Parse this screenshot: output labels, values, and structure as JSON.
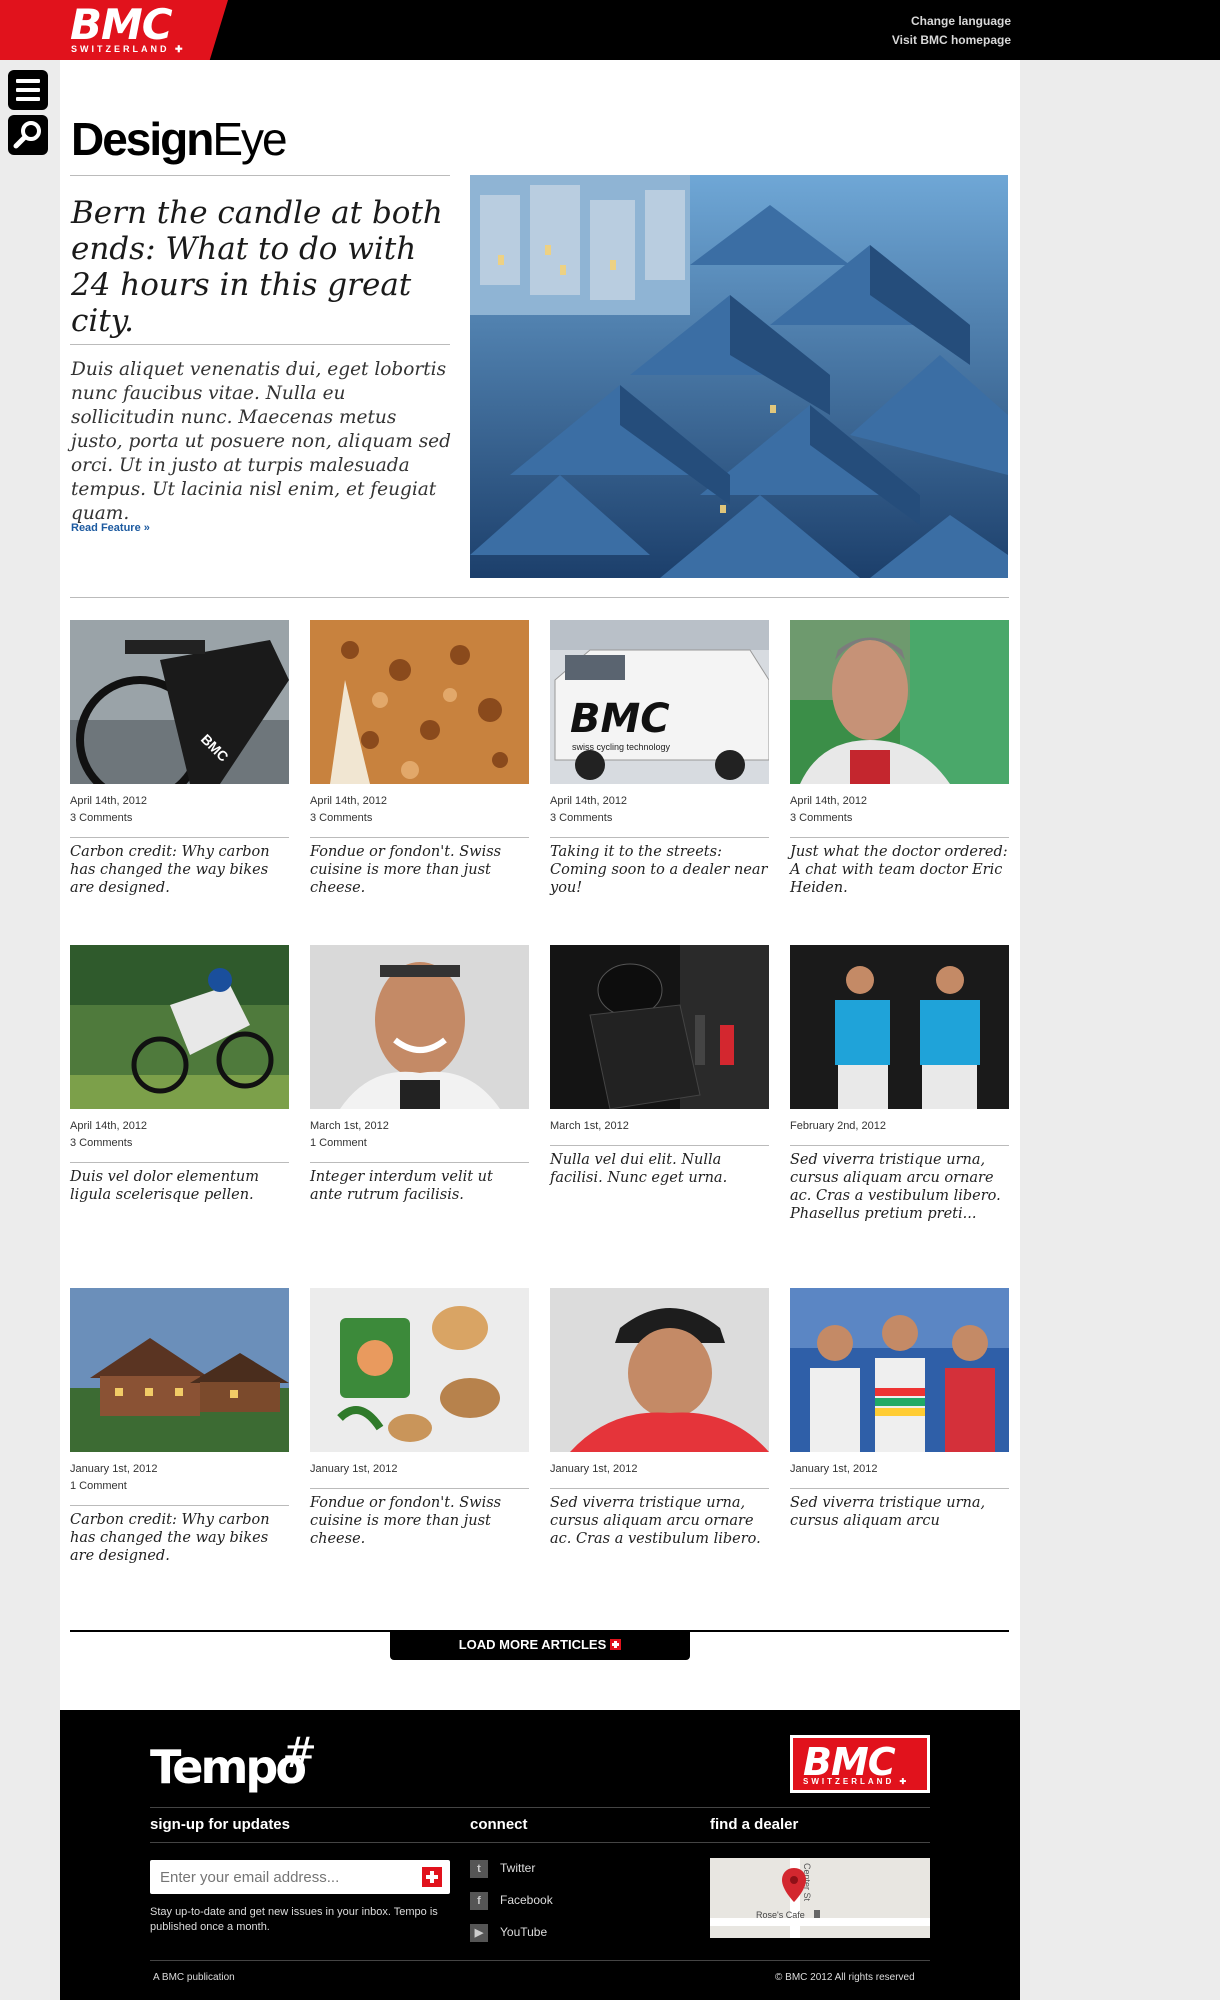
{
  "header": {
    "logo_text": "BMC",
    "logo_sub": "SWITZERLAND",
    "links": [
      "Change language",
      "Visit BMC homepage"
    ]
  },
  "brand": {
    "bold": "Design",
    "light": "Eye"
  },
  "hero": {
    "title": "Bern the candle at both ends: What to do with 24 hours in this great city.",
    "text": "Duis aliquet venenatis dui, eget lobortis nunc faucibus vitae. Nulla eu sollicitudin nunc. Maecenas metus justo, porta ut posuere non, aliquam sed orci. Ut in justo at turpis malesuada tempus. Ut lacinia nisl enim, et feugiat quam.",
    "read_more": "Read Feature »"
  },
  "articles": [
    {
      "date": "April 14th, 2012",
      "comments": "3 Comments",
      "title": "Carbon credit: Why carbon has changed the way bikes are designed."
    },
    {
      "date": "April 14th, 2012",
      "comments": "3 Comments",
      "title": "Fondue or fondon't. Swiss cuisine is more than just cheese."
    },
    {
      "date": "April 14th, 2012",
      "comments": "3 Comments",
      "title": "Taking it to the streets: Coming soon to a dealer near you!"
    },
    {
      "date": "April 14th, 2012",
      "comments": "3 Comments",
      "title": "Just what the doctor ordered: A chat with team doctor Eric Heiden."
    },
    {
      "date": "April 14th, 2012",
      "comments": "3 Comments",
      "title": "Duis vel dolor elementum ligula scelerisque pellen."
    },
    {
      "date": "March 1st, 2012",
      "comments": "1 Comment",
      "title": "Integer interdum velit ut ante rutrum facilisis."
    },
    {
      "date": "March 1st, 2012",
      "comments": "",
      "title": "Nulla vel dui elit. Nulla facilisi. Nunc eget urna."
    },
    {
      "date": "February 2nd, 2012",
      "comments": "",
      "title": "Sed viverra tristique urna, cursus aliquam arcu ornare ac. Cras a vestibulum libero. Phasellus pretium preti..."
    },
    {
      "date": "January 1st, 2012",
      "comments": "1 Comment",
      "title": "Carbon credit: Why carbon has changed the way bikes are designed."
    },
    {
      "date": "January 1st, 2012",
      "comments": "",
      "title": "Fondue or fondon't. Swiss cuisine is more than just cheese."
    },
    {
      "date": "January 1st, 2012",
      "comments": "",
      "title": "Sed viverra tristique urna, cursus aliquam arcu ornare ac. Cras a vestibulum libero."
    },
    {
      "date": "January 1st, 2012",
      "comments": "",
      "title": "Sed viverra tristique urna, cursus aliquam arcu"
    }
  ],
  "load_more": "LOAD MORE ARTICLES",
  "footer": {
    "tempo": "Tempo",
    "tempo_mark": "#",
    "logo_text": "BMC",
    "logo_sub": "SWITZERLAND",
    "signup_heading": "sign-up for updates",
    "connect_heading": "connect",
    "dealer_heading": "find a dealer",
    "email_placeholder": "Enter your email address...",
    "signup_info": "Stay up-to-date and get new issues in your inbox. Tempo is published once a month.",
    "social": [
      "Twitter",
      "Facebook",
      "YouTube"
    ],
    "map_street": "Center St",
    "map_place": "Rose's Cafe",
    "publication": "A BMC publication",
    "copyright": "© BMC 2012 All rights reserved"
  },
  "colors": {
    "brand_red": "#e1121c",
    "link_blue": "#1c5aa0",
    "black": "#000000"
  }
}
